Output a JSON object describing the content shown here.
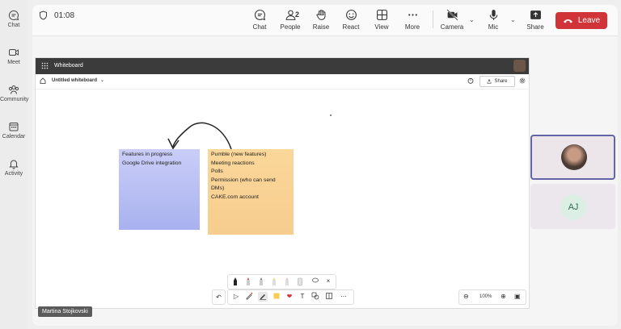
{
  "rail": {
    "items": [
      {
        "label": "Chat",
        "icon": "chat-icon"
      },
      {
        "label": "Meet",
        "icon": "video-icon"
      },
      {
        "label": "Community",
        "icon": "community-icon"
      },
      {
        "label": "Calendar",
        "icon": "calendar-icon"
      },
      {
        "label": "Activity",
        "icon": "bell-icon"
      }
    ]
  },
  "topbar": {
    "timer": "01:08",
    "chat": "Chat",
    "people": "People",
    "people_count": "2",
    "raise": "Raise",
    "react": "React",
    "view": "View",
    "more": "More",
    "camera": "Camera",
    "mic": "Mic",
    "share": "Share",
    "leave": "Leave"
  },
  "whiteboard": {
    "app_title": "Whiteboard",
    "doc_name": "Untitled whiteboard",
    "share": "Share",
    "notes": {
      "blue": [
        "Features in progress",
        "Google Drive integration"
      ],
      "yellow": [
        "Pumble (new features)",
        "Meeting reactions",
        "Polls",
        "Permission (who can send",
        "DMs)",
        "CAKE.com account"
      ]
    },
    "zoom": "100%"
  },
  "participant_name": "Martina Stojkovski",
  "tiles": {
    "other_initials": "AJ"
  },
  "colors": {
    "leave": "#d13438",
    "active_border": "#6264a7",
    "note_blue": "#b8bff3",
    "note_yellow": "#f8d196"
  }
}
